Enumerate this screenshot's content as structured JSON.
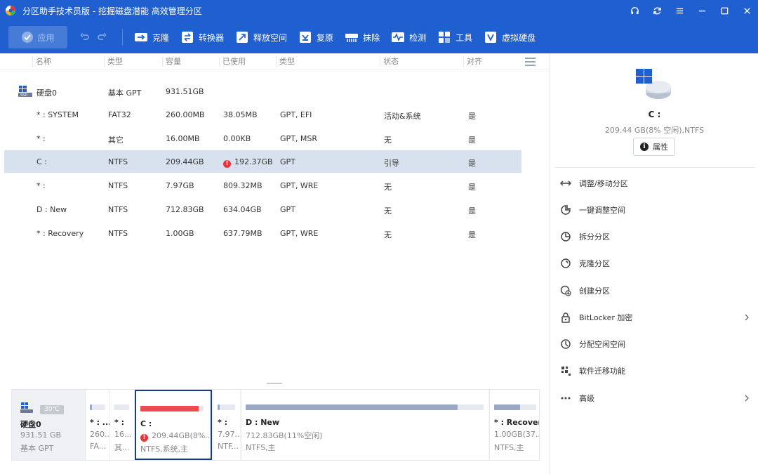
{
  "window": {
    "title": "分区助手技术员版 - 挖掘磁盘潜能 高效管理分区"
  },
  "toolbar": {
    "apply": "应用",
    "items": [
      {
        "label": "克隆",
        "icon": "clone-icon"
      },
      {
        "label": "转换器",
        "icon": "convert-icon"
      },
      {
        "label": "释放空间",
        "icon": "free-space-icon"
      },
      {
        "label": "复原",
        "icon": "recovery-icon"
      },
      {
        "label": "抹除",
        "icon": "wipe-icon"
      },
      {
        "label": "检测",
        "icon": "check-icon"
      },
      {
        "label": "工具",
        "icon": "tools-icon"
      },
      {
        "label": "虚拟硬盘",
        "icon": "virtual-disk-icon"
      }
    ]
  },
  "table": {
    "headers": [
      "名称",
      "类型",
      "容量",
      "已使用",
      "类型",
      "状态",
      "对齐"
    ],
    "disk": {
      "name": "硬盘0",
      "type": "基本 GPT",
      "capacity": "931.51GB"
    },
    "rows": [
      {
        "name": "* : SYSTEM",
        "type": "FAT32",
        "capacity": "260.00MB",
        "used": "38.05MB",
        "ptype": "GPT, EFI",
        "status": "活动&系统",
        "align": "是"
      },
      {
        "name": "* :",
        "type": "其它",
        "capacity": "16.00MB",
        "used": "0.00KB",
        "ptype": "GPT, MSR",
        "status": "无",
        "align": "是"
      },
      {
        "name": "C :",
        "type": "NTFS",
        "capacity": "209.44GB",
        "used": "192.37GB",
        "ptype": "GPT",
        "status": "引导",
        "align": "是",
        "warning": true,
        "selected": true
      },
      {
        "name": "* :",
        "type": "NTFS",
        "capacity": "7.97GB",
        "used": "809.32MB",
        "ptype": "GPT, WRE",
        "status": "无",
        "align": "是"
      },
      {
        "name": "D : New",
        "type": "NTFS",
        "capacity": "712.83GB",
        "used": "634.04GB",
        "ptype": "GPT",
        "status": "无",
        "align": "是"
      },
      {
        "name": "* : Recovery",
        "type": "NTFS",
        "capacity": "1.00GB",
        "used": "637.79MB",
        "ptype": "GPT, WRE",
        "status": "无",
        "align": "是"
      }
    ]
  },
  "panel": {
    "name": "C :",
    "info": "209.44 GB(8% 空闲),NTFS",
    "props": "属性",
    "ops": [
      {
        "label": "调整/移动分区",
        "icon": "resize-move-icon",
        "arrow": false
      },
      {
        "label": "一键调整空间",
        "icon": "quick-adjust-icon",
        "arrow": false
      },
      {
        "label": "拆分分区",
        "icon": "split-partition-icon",
        "arrow": false
      },
      {
        "label": "克隆分区",
        "icon": "clone-partition-icon",
        "arrow": false
      },
      {
        "label": "创建分区",
        "icon": "create-partition-icon",
        "arrow": false
      },
      {
        "label": "BitLocker 加密",
        "icon": "lock-icon",
        "arrow": true
      },
      {
        "label": "分配空闲空间",
        "icon": "allocate-space-icon",
        "arrow": false
      },
      {
        "label": "软件迁移功能",
        "icon": "app-migrate-icon",
        "arrow": false
      },
      {
        "label": "高级",
        "icon": "more-icon",
        "arrow": true
      }
    ]
  },
  "diskmap": {
    "disk": {
      "name": "硬盘0",
      "size": "931.51 GB",
      "type": "基本 GPT",
      "temp": "30℃"
    },
    "parts": [
      {
        "name": "* : ...",
        "size": "260...",
        "fs": "FA...",
        "fill": 0.15
      },
      {
        "name": "* :",
        "size": "16...",
        "fs": "其...",
        "fill": 0.0
      },
      {
        "name": "C :",
        "size": "209.44GB(8%...",
        "fs": "NTFS,系统,主",
        "fill": 0.92,
        "selected": true,
        "warning": true
      },
      {
        "name": "* :",
        "size": "7.97...",
        "fs": "NTF...",
        "fill": 0.1
      },
      {
        "name": "D : New",
        "size": "712.83GB(11%空闲)",
        "fs": "NTFS,主",
        "fill": 0.89
      },
      {
        "name": "* : Recovery",
        "size": "1.00GB(37...",
        "fs": "NTFS,主",
        "fill": 0.62
      }
    ]
  },
  "colors": {
    "brand": "#1f5fd0",
    "selected_row": "#d8e2ef",
    "warning": "#e8333a",
    "bar_fill": "#9aa8c4"
  }
}
